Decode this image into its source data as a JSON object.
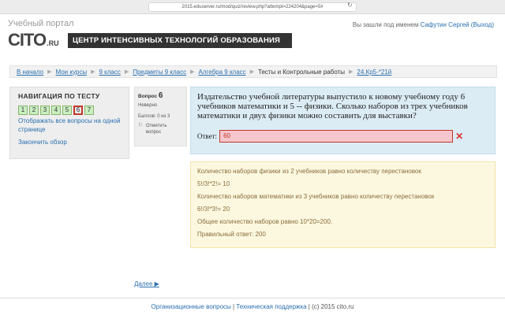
{
  "browser": {
    "url": "2015.eduserver.ru/mod/quiz/review.php?attempt=224204&page=5#"
  },
  "header": {
    "portal_title": "Учебный портал",
    "login_prefix": "Вы зашли под именем",
    "user_name": "Сафутин Сергей",
    "logout": "(Выход)",
    "logo_text": "CITO",
    "logo_suffix": ".RU",
    "banner": "ЦЕНТР ИНТЕНСИВНЫХ ТЕХНОЛОГИЙ ОБРАЗОВАНИЯ"
  },
  "breadcrumb": [
    "В начало",
    "Мои курсы",
    "9 класс",
    "Предметы 9 класс",
    "Алгебра 9 класс",
    "Тесты и Контрольные работы",
    "24.Кр5-*21й"
  ],
  "nav": {
    "title": "НАВИГАЦИЯ ПО ТЕСТУ",
    "questions": [
      "1",
      "2",
      "3",
      "4",
      "5",
      "6",
      "7"
    ],
    "current": "6",
    "show_all": "Отображать все вопросы на одной странице",
    "finish": "Закончить обзор"
  },
  "question": {
    "label": "Вопрос",
    "number": "6",
    "status": "Неверно",
    "grade": "Баллов: 0 из 3",
    "flag": "Отметить вопрос",
    "text": "Издательство учебной литературы выпустило к новому учебному году 6 учебников математики и 5 -- физики. Сколько наборов из трех учебников математики и двух физики можно составить для выставки?",
    "answer_label": "Ответ:",
    "answer_value": "60"
  },
  "feedback": [
    "Количество наборов физики из 2 учебников равно количеству перестановок",
    "5!/3!*2!= 10",
    "Количество наборов математики из 3 учебников равно количеству перестановок",
    "6!/3!*3!= 20",
    "Общее количество наборов равно 10*20=200.",
    "Правильный ответ: 200"
  ],
  "next": "Далее",
  "footer": {
    "link1": "Организационные вопросы",
    "link2": "Техническая поддержка",
    "copyright": "(c) 2015 cito.ru"
  },
  "colors": {
    "link": "#2a6fb0",
    "error": "#c0392b",
    "question_bg": "#dcecf5",
    "feedback_bg": "#fcf8e0",
    "answered": "#c9eec2"
  }
}
